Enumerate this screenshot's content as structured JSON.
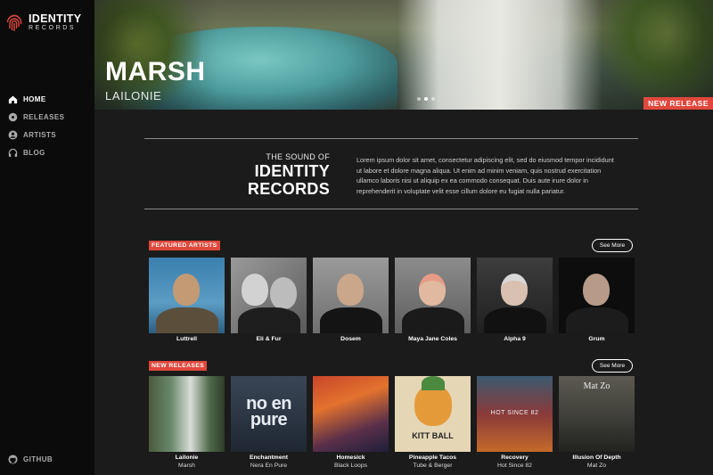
{
  "brand": {
    "title": "IDENTITY",
    "subtitle": "RECORDS"
  },
  "nav": [
    {
      "label": "HOME",
      "icon": "home-icon",
      "active": true
    },
    {
      "label": "RELEASES",
      "icon": "disc-icon",
      "active": false
    },
    {
      "label": "ARTISTS",
      "icon": "user-icon",
      "active": false
    },
    {
      "label": "BLOG",
      "icon": "headphones-icon",
      "active": false
    }
  ],
  "footer_link": {
    "label": "GITHUB",
    "icon": "github-icon"
  },
  "hero": {
    "title": "MARSH",
    "subtitle": "LAILONIE",
    "badge": "NEW RELEASE",
    "slides": 3,
    "active_slide": 2
  },
  "intro": {
    "pre": "THE SOUND OF",
    "line1": "IDENTITY",
    "line2": "RECORDS",
    "body": "Lorem ipsum dolor sit amet, consectetur adipiscing elit, sed do eiusmod tempor incididunt ut labore et dolore magna aliqua. Ut enim ad minim veniam, quis nostrud exercitation ullamco laboris nisi ut aliquip ex ea commodo consequat. Duis aute irure dolor in reprehenderit in voluptate velit esse cillum dolore eu fugiat nulla pariatur."
  },
  "featured": {
    "label": "FEATURED ARTISTS",
    "see_more": "See More",
    "items": [
      {
        "name": "Luttrell"
      },
      {
        "name": "Eli & Fur"
      },
      {
        "name": "Dosem"
      },
      {
        "name": "Maya Jane Coles"
      },
      {
        "name": "Alpha 9"
      },
      {
        "name": "Grum"
      }
    ]
  },
  "releases": {
    "label": "NEW RELEASES",
    "see_more": "See More",
    "items": [
      {
        "title": "Lailonie",
        "artist": "Marsh"
      },
      {
        "title": "Enchantment",
        "artist": "Nera En Pure",
        "art_text": "no en pure"
      },
      {
        "title": "Homesick",
        "artist": "Black Loops"
      },
      {
        "title": "Pineapple Tacos",
        "artist": "Tube & Berger",
        "art_text": "KITT BALL"
      },
      {
        "title": "Recovery",
        "artist": "Hot Since 82",
        "art_text": "HOT SINCE 82"
      },
      {
        "title": "Illusion Of Depth",
        "artist": "Mat Zo",
        "art_text": "Mat Zo"
      }
    ]
  },
  "colors": {
    "accent": "#e0473c",
    "sidebar": "#0b0b0b",
    "background": "#1b1b1b"
  }
}
